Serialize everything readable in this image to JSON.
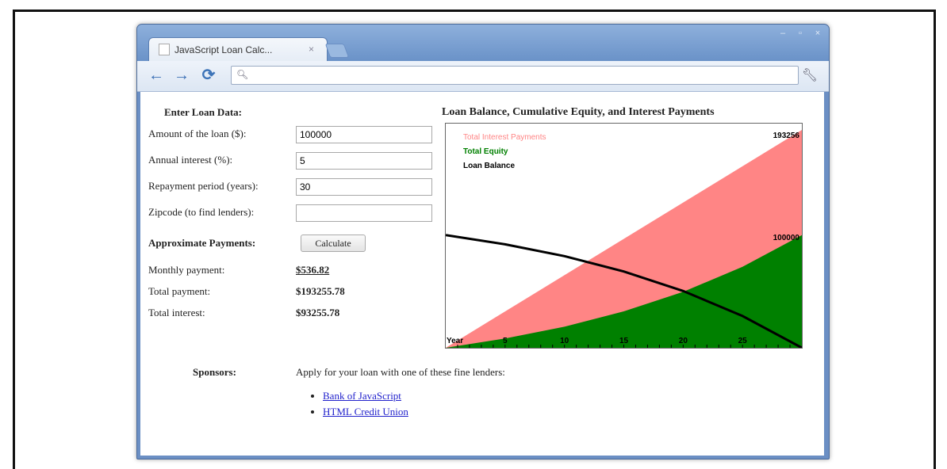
{
  "browser": {
    "tab_title": "JavaScript Loan Calc...",
    "tab_close": "×",
    "address_value": "",
    "colors": {
      "titlebar": "#7aa0d4",
      "accent": "#3a6fb5"
    }
  },
  "form": {
    "heading": "Enter Loan Data:",
    "amount_label": "Amount of the loan ($):",
    "amount_value": "100000",
    "interest_label": "Annual interest (%):",
    "interest_value": "5",
    "period_label": "Repayment period (years):",
    "period_value": "30",
    "zip_label": "Zipcode (to find lenders):",
    "zip_value": "",
    "payments_heading": "Approximate Payments:",
    "calculate_label": "Calculate"
  },
  "results": {
    "monthly_label": "Monthly payment:",
    "monthly_value": "$536.82",
    "total_label": "Total payment:",
    "total_value": "$193255.78",
    "interest_label": "Total interest:",
    "interest_value": "$93255.78"
  },
  "sponsors": {
    "heading": "Sponsors:",
    "intro": "Apply for your loan with one of these fine lenders:",
    "lenders": [
      "Bank of JavaScript",
      "HTML Credit Union"
    ]
  },
  "chart": {
    "title": "Loan Balance, Cumulative Equity, and Interest Payments",
    "legend": [
      "Total Interest Payments",
      "Total Equity",
      "Loan Balance"
    ],
    "max_label_top": "193256",
    "max_label_mid": "100000",
    "x_axis_label": "Year",
    "colors": {
      "interest": "#ff8585",
      "equity": "#008000",
      "balance": "#000000"
    }
  },
  "chart_data": {
    "type": "area",
    "title": "Loan Balance, Cumulative Equity, and Interest Payments",
    "xlabel": "Year",
    "x_ticks": [
      5,
      10,
      15,
      20,
      25
    ],
    "xlim": [
      0,
      30
    ],
    "ylim": [
      0,
      193256
    ],
    "series": [
      {
        "name": "Total Interest Payments",
        "x": [
          0,
          30
        ],
        "y": [
          0,
          193256
        ]
      },
      {
        "name": "Total Equity",
        "x": [
          0,
          5,
          10,
          15,
          20,
          25,
          30
        ],
        "y": [
          0,
          8200,
          18700,
          32300,
          49600,
          71800,
          100000
        ]
      },
      {
        "name": "Loan Balance",
        "x": [
          0,
          5,
          10,
          15,
          20,
          25,
          30
        ],
        "y": [
          100000,
          91800,
          81300,
          67700,
          50400,
          28200,
          0
        ]
      }
    ]
  }
}
